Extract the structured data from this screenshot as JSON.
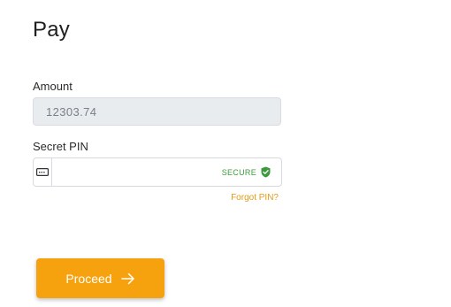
{
  "page": {
    "title": "Pay"
  },
  "amount": {
    "label": "Amount",
    "value": "12303.74"
  },
  "pin": {
    "label": "Secret PIN",
    "placeholder": "",
    "value": "",
    "secure_text": "SECURE",
    "icon": "keyboard-icon",
    "secure_icon": "shield-check-icon",
    "forgot_link": "Forgot PIN?"
  },
  "actions": {
    "proceed_label": "Proceed",
    "proceed_icon": "arrow-right-icon"
  },
  "colors": {
    "accent": "#f6a20f",
    "secure": "#3c9a3c",
    "link": "#e49a16"
  }
}
